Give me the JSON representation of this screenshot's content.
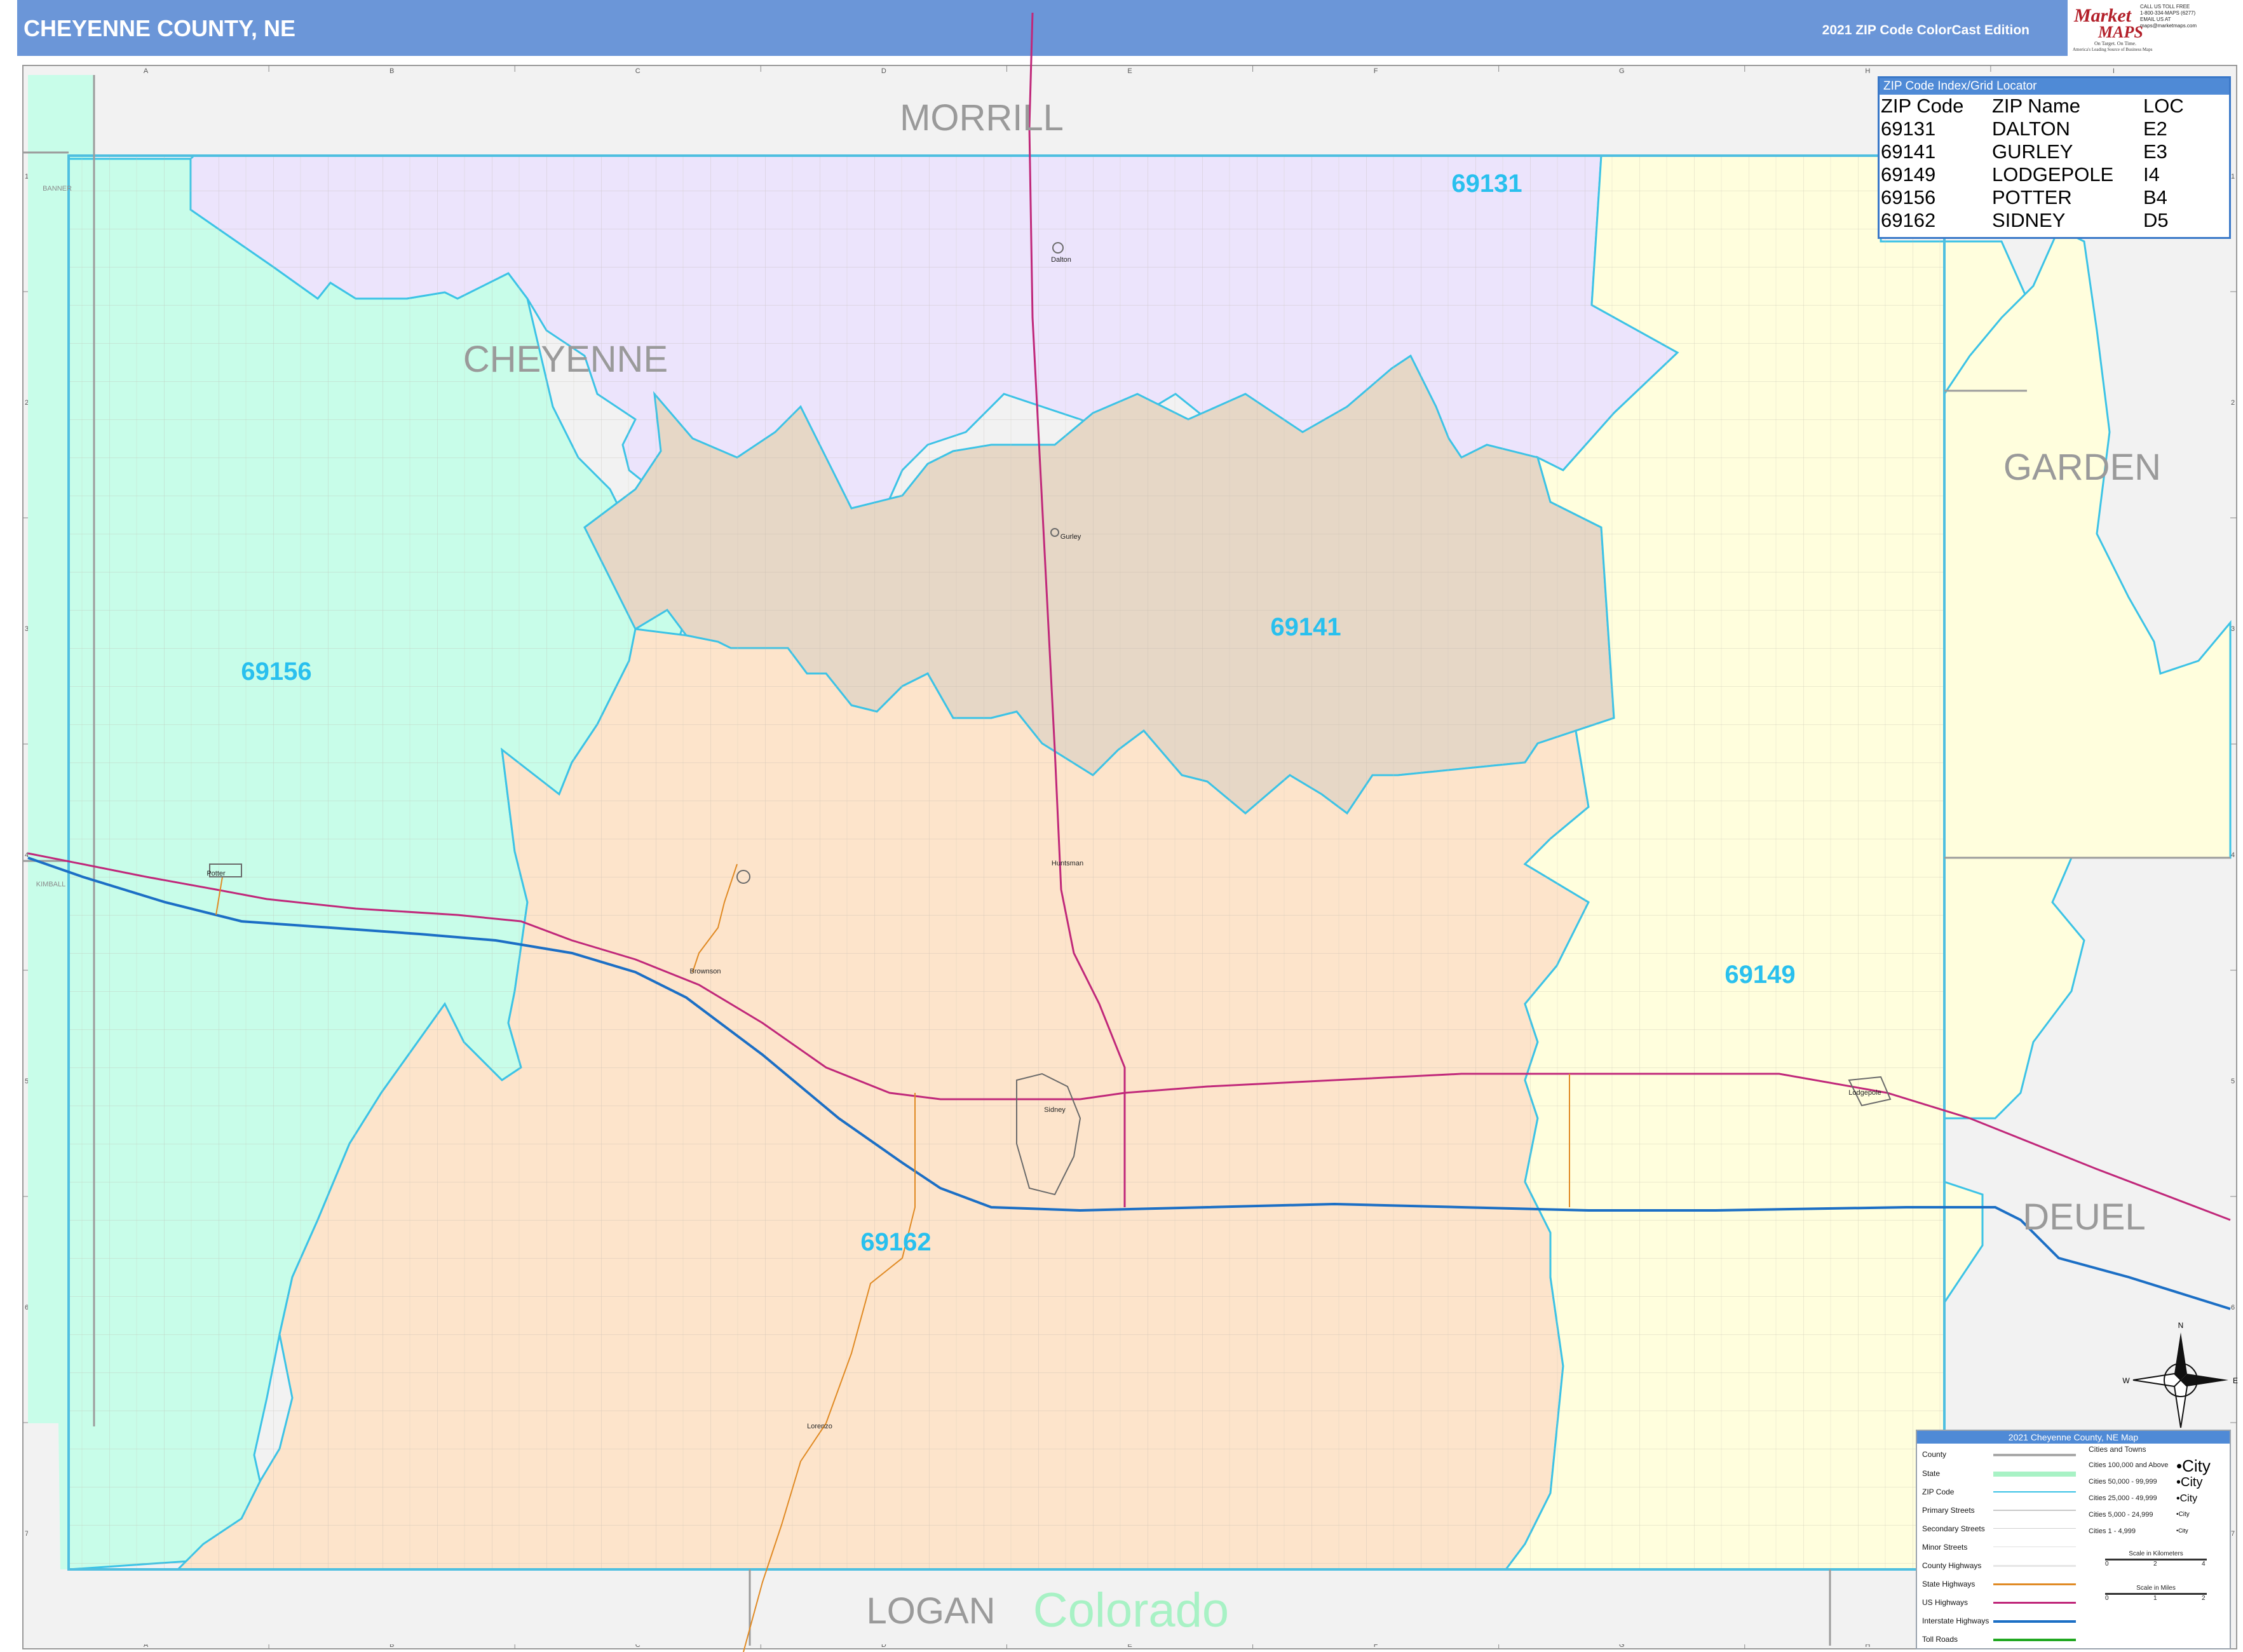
{
  "header": {
    "title": "CHEYENNE COUNTY, NE",
    "edition": "2021 ZIP Code ColorCast Edition",
    "logo_word_1": "Market",
    "logo_word_2": "MAPS",
    "logo_tagline": "On Target. On Time.",
    "logo_slogan": "America's Leading Source of Business Maps",
    "contact": [
      "CALL US TOLL FREE",
      "1-800-334-MAPS (6277)",
      "EMAIL US AT",
      "maps@marketmaps.com"
    ]
  },
  "grid": {
    "columns": [
      "A",
      "B",
      "C",
      "D",
      "E",
      "F",
      "G",
      "H",
      "I"
    ],
    "rows": [
      "1",
      "2",
      "3",
      "4",
      "5",
      "6",
      "7"
    ]
  },
  "map": {
    "neighbor_counties": {
      "morrill": "MORRILL",
      "garden": "GARDEN",
      "deuel": "DEUEL",
      "logan": "LOGAN",
      "banner": "BANNER",
      "kimball": "KIMBALL"
    },
    "state_label": "Colorado",
    "county_label": "CHEYENNE",
    "zip_colors": {
      "69131": "#ece4fc",
      "69141": "#e6d7c6",
      "69149": "#fffedd",
      "69156": "#c8fde9",
      "69162": "#fde4cb"
    },
    "zip_labels": [
      "69131",
      "69141",
      "69149",
      "69156",
      "69162"
    ],
    "towns": {
      "dalton": "Dalton",
      "gurley": "Gurley",
      "lodgepole": "Lodgepole",
      "potter": "Potter",
      "sidney": "Sidney",
      "huntsman": "Huntsman",
      "brownson": "Brownson",
      "lorenzo": "Lorenzo"
    },
    "colors": {
      "zip_boundary": "#3cc3e6",
      "interstate": "#1c6fc5",
      "us_highway": "#c0287a",
      "state_highway": "#e08a24",
      "county_line": "#9c9c9c"
    }
  },
  "zip_index": {
    "title": "ZIP Code Index/Grid Locator",
    "headers": [
      "ZIP Code",
      "ZIP Name",
      "LOC"
    ],
    "rows": [
      [
        "69131",
        "DALTON",
        "E2"
      ],
      [
        "69141",
        "GURLEY",
        "E3"
      ],
      [
        "69149",
        "LODGEPOLE",
        "I4"
      ],
      [
        "69156",
        "POTTER",
        "B4"
      ],
      [
        "69162",
        "SIDNEY",
        "D5"
      ]
    ]
  },
  "legend": {
    "title": "2021 Cheyenne County, NE Map",
    "cities_title": "Cities and Towns",
    "items": [
      "County",
      "State",
      "ZIP Code",
      "Primary Streets",
      "Secondary Streets",
      "Minor Streets",
      "County Highways",
      "State Highways",
      "US Highways",
      "Interstate Highways",
      "Toll Roads"
    ],
    "city_classes": [
      "Cities 100,000 and Above",
      "Cities 50,000 - 99,999",
      "Cities 25,000 - 49,999",
      "Cities 5,000 - 24,999",
      "Cities 1 - 4,999"
    ],
    "city_samples": [
      "•City",
      "•City",
      "•City",
      "•City",
      "•City"
    ],
    "scale_km": "Scale in Kilometers",
    "scale_miles": "Scale in Miles",
    "scale_km_ticks": [
      "0",
      "2",
      "4"
    ],
    "scale_mi_ticks": [
      "0",
      "1",
      "2"
    ]
  },
  "compass": {
    "n": "N",
    "s": "S",
    "e": "E",
    "w": "W"
  }
}
